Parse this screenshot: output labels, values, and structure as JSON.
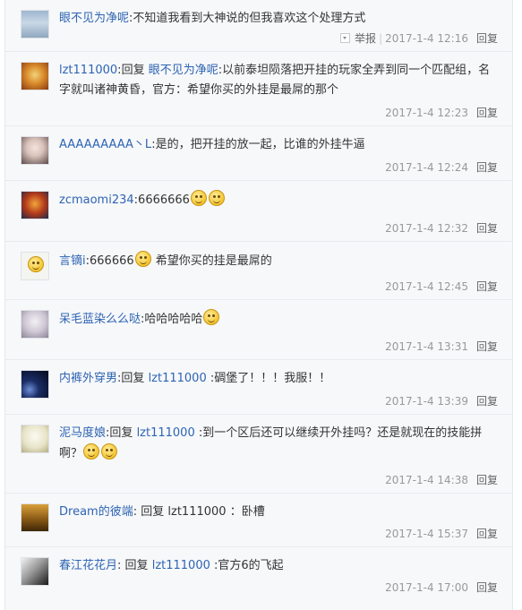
{
  "colors": {
    "link": "#2d64b3",
    "text": "#333333",
    "meta": "#999999",
    "background": "#f7f8fa"
  },
  "replies": [
    {
      "user": "眼不见为净呢",
      "colon": ":",
      "reply_label": "",
      "target": "",
      "text_after": "不知道我看到大神说的但我喜欢这个处理方式",
      "report": "举报",
      "separator": "|",
      "time": "2017-1-4 12:16",
      "reply_button": "回复"
    },
    {
      "user": "lzt111000",
      "colon": ":",
      "reply_label": "回复",
      "target": "眼不见为净呢",
      "text_after": ":以前泰坦陨落把开挂的玩家全弄到同一个匹配组，名字就叫诸神黄昏，官方：希望你买的外挂是最屌的那个",
      "time": "2017-1-4 12:23",
      "reply_button": "回复"
    },
    {
      "user": "AAAAAAAAA丶L",
      "colon": ":",
      "text_after": "是的，把开挂的放一起，比谁的外挂牛逼",
      "time": "2017-1-4 12:24",
      "reply_button": "回复"
    },
    {
      "user": "zcmaomi234",
      "colon": ":",
      "text_after": "6666666",
      "emoticons": "smile-emoticon x2",
      "time": "2017-1-4 12:32",
      "reply_button": "回复"
    },
    {
      "user": "言镝i",
      "colon": ":",
      "text_after": "666666",
      "text_tail": "希望你买的挂是最屌的",
      "time": "2017-1-4 12:45",
      "reply_button": "回复"
    },
    {
      "user": "呆毛蓝染么么哒",
      "colon": ":",
      "text_after": "哈哈哈哈哈",
      "time": "2017-1-4 13:31",
      "reply_button": "回复"
    },
    {
      "user": "内裤外穿男",
      "colon": ":",
      "reply_label": "回复",
      "target": "lzt111000",
      "text_after": ":碉堡了！！！我服！！",
      "time": "2017-1-4 13:39",
      "reply_button": "回复"
    },
    {
      "user": "泥马度娘",
      "colon": ":",
      "reply_label": "回复",
      "target": "lzt111000",
      "text_after": ":到一个区后还可以继续开外挂吗？还是就现在的技能拼啊？",
      "time": "2017-1-4 14:38",
      "reply_button": "回复"
    },
    {
      "user": "Dream的彼端",
      "colon": ":",
      "reply_label": "回复",
      "target_plain": "lzt111000",
      "text_after": "：卧槽",
      "time": "2017-1-4 15:37",
      "reply_button": "回复"
    },
    {
      "user": "春江花花月",
      "colon": ":",
      "reply_label": "回复",
      "target": "lzt111000",
      "text_after": ":官方6的飞起",
      "time": "2017-1-4 17:00",
      "reply_button": "回复"
    }
  ]
}
